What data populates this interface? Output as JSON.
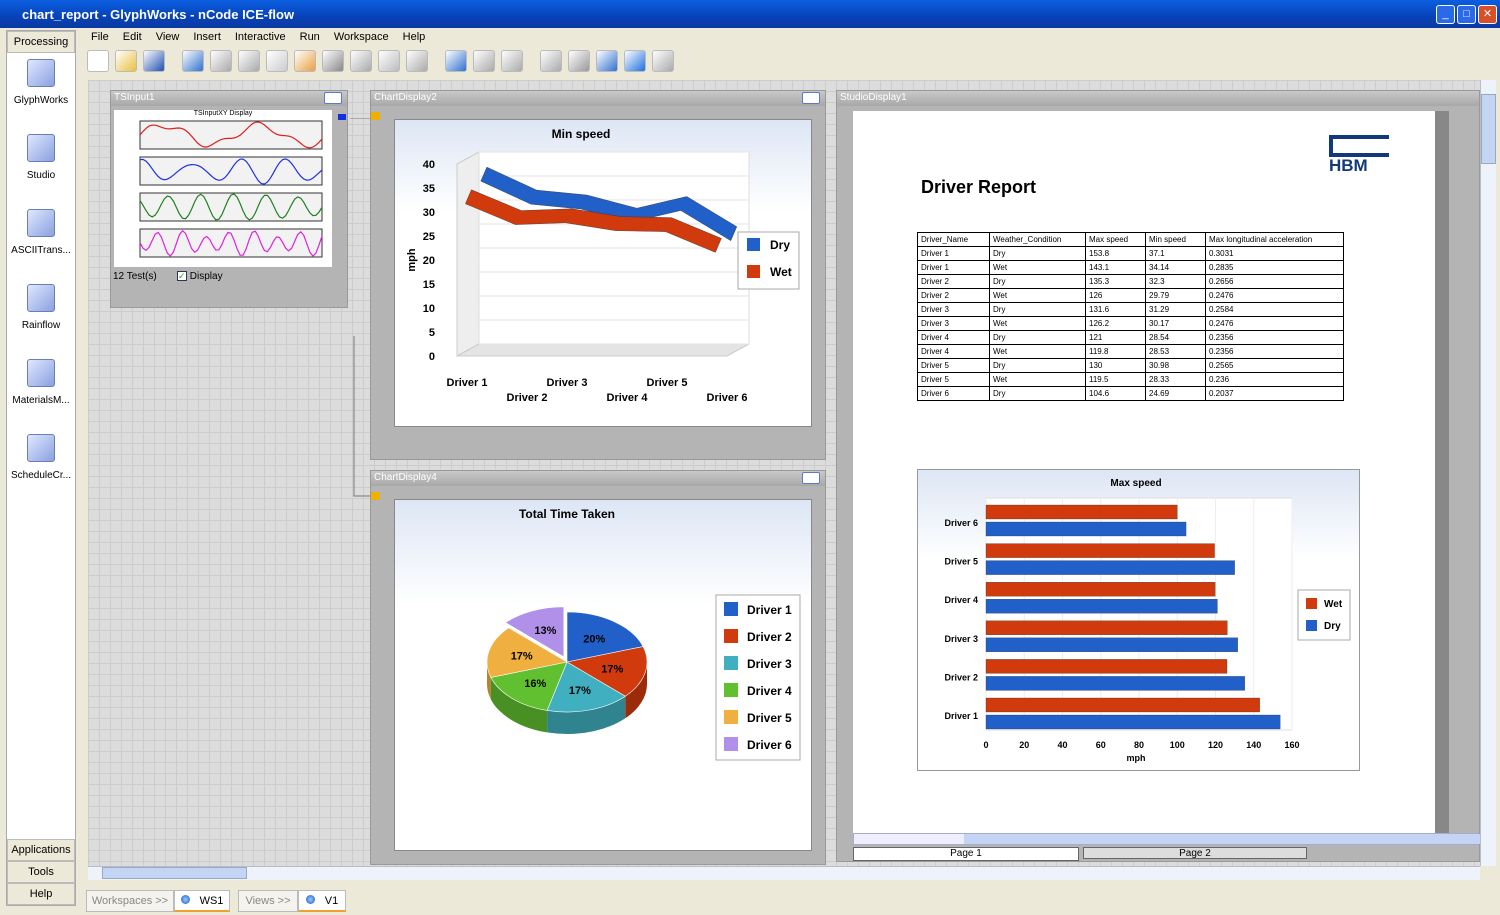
{
  "window": {
    "title": "chart_report - GlyphWorks - nCode ICE-flow"
  },
  "sidebar": {
    "header": "Processing",
    "items": [
      {
        "label": "GlyphWorks"
      },
      {
        "label": "Studio"
      },
      {
        "label": "ASCIITrans..."
      },
      {
        "label": "Rainflow"
      },
      {
        "label": "MaterialsM..."
      },
      {
        "label": "ScheduleCr..."
      }
    ],
    "footer": [
      "Applications",
      "Tools",
      "Help"
    ]
  },
  "menu": [
    "File",
    "Edit",
    "View",
    "Insert",
    "Interactive",
    "Run",
    "Workspace",
    "Help"
  ],
  "toolbar": [
    "new-icon",
    "open-icon",
    "save-icon",
    "undo-icon",
    "redo-icon",
    "cut-icon",
    "copy-icon",
    "paste-icon",
    "delete-icon",
    "settings-icon",
    "properties-icon",
    "refresh-icon",
    "step-down-icon",
    "step-icon",
    "fast-forward-icon",
    "rewind-icon",
    "stop-icon",
    "step-run-icon",
    "play-icon",
    "pause-icon"
  ],
  "panels": {
    "tsinput": {
      "title": "TSInput1",
      "chart_title": "TSInputXY Display",
      "tests": "12 Test(s)",
      "display_label": "Display",
      "display_checked": true
    },
    "chart2": {
      "title": "ChartDisplay2"
    },
    "chart4": {
      "title": "ChartDisplay4"
    },
    "studio": {
      "title": "StudioDisplay1",
      "report_title": "Driver Report",
      "logo": "HBM",
      "pages": [
        "Page 1",
        "Page 2"
      ]
    }
  },
  "table": {
    "headers": [
      "Driver_Name",
      "Weather_Condition",
      "Max speed",
      "Min speed",
      "Max longitudinal acceleration"
    ],
    "rows": [
      [
        "Driver 1",
        "Dry",
        "153.8",
        "37.1",
        "0.3031"
      ],
      [
        "Driver 1",
        "Wet",
        "143.1",
        "34.14",
        "0.2835"
      ],
      [
        "Driver 2",
        "Dry",
        "135.3",
        "32.3",
        "0.2656"
      ],
      [
        "Driver 2",
        "Wet",
        "126",
        "29.79",
        "0.2476"
      ],
      [
        "Driver 3",
        "Dry",
        "131.6",
        "31.29",
        "0.2584"
      ],
      [
        "Driver 3",
        "Wet",
        "126.2",
        "30.17",
        "0.2476"
      ],
      [
        "Driver 4",
        "Dry",
        "121",
        "28.54",
        "0.2356"
      ],
      [
        "Driver 4",
        "Wet",
        "119.8",
        "28.53",
        "0.2356"
      ],
      [
        "Driver 5",
        "Dry",
        "130",
        "30.98",
        "0.2565"
      ],
      [
        "Driver 5",
        "Wet",
        "119.5",
        "28.33",
        "0.236"
      ],
      [
        "Driver 6",
        "Dry",
        "104.6",
        "24.69",
        "0.2037"
      ]
    ]
  },
  "chart_data": [
    {
      "type": "area",
      "title": "Min speed",
      "ylabel": "mph",
      "categories": [
        "Driver 1",
        "Driver 2",
        "Driver 3",
        "Driver 4",
        "Driver 5",
        "Driver 6"
      ],
      "ylim": [
        0,
        40
      ],
      "yticks": [
        0,
        5,
        10,
        15,
        20,
        25,
        30,
        35,
        40
      ],
      "grid": true,
      "legend": "right",
      "series": [
        {
          "name": "Dry",
          "color": "#2060c8",
          "values": [
            37.1,
            32.3,
            31.29,
            28.54,
            30.98,
            24.69
          ]
        },
        {
          "name": "Wet",
          "color": "#d03a0c",
          "values": [
            34.14,
            29.79,
            30.17,
            28.53,
            28.33,
            24
          ]
        }
      ]
    },
    {
      "type": "pie",
      "title": "Total Time Taken",
      "legend": "right",
      "categories": [
        "Driver 1",
        "Driver 2",
        "Driver 3",
        "Driver 4",
        "Driver 5",
        "Driver 6"
      ],
      "values": [
        20,
        17,
        17,
        16,
        17,
        13
      ],
      "labels": [
        "20%",
        "17%",
        "17%",
        "16%",
        "17%",
        "13%"
      ],
      "colors": [
        "#2060c8",
        "#d03a0c",
        "#40b0c0",
        "#60c030",
        "#f0b040",
        "#b090e8"
      ]
    },
    {
      "type": "bar",
      "orientation": "horizontal",
      "title": "Max speed",
      "xlabel": "mph",
      "xlim": [
        0,
        160
      ],
      "xticks": [
        0,
        20,
        40,
        60,
        80,
        100,
        120,
        140,
        160
      ],
      "grid": true,
      "legend": "right",
      "categories": [
        "Driver 1",
        "Driver 2",
        "Driver 3",
        "Driver 4",
        "Driver 5",
        "Driver 6"
      ],
      "series": [
        {
          "name": "Wet",
          "color": "#d03a0c",
          "values": [
            143.1,
            126,
            126.2,
            119.8,
            119.5,
            100
          ]
        },
        {
          "name": "Dry",
          "color": "#2060c8",
          "values": [
            153.8,
            135.3,
            131.6,
            121,
            130,
            104.6
          ]
        }
      ]
    }
  ],
  "bottom_tabs": {
    "workspaces": "Workspaces >>",
    "ws": "WS1",
    "views": "Views >>",
    "view": "V1"
  }
}
